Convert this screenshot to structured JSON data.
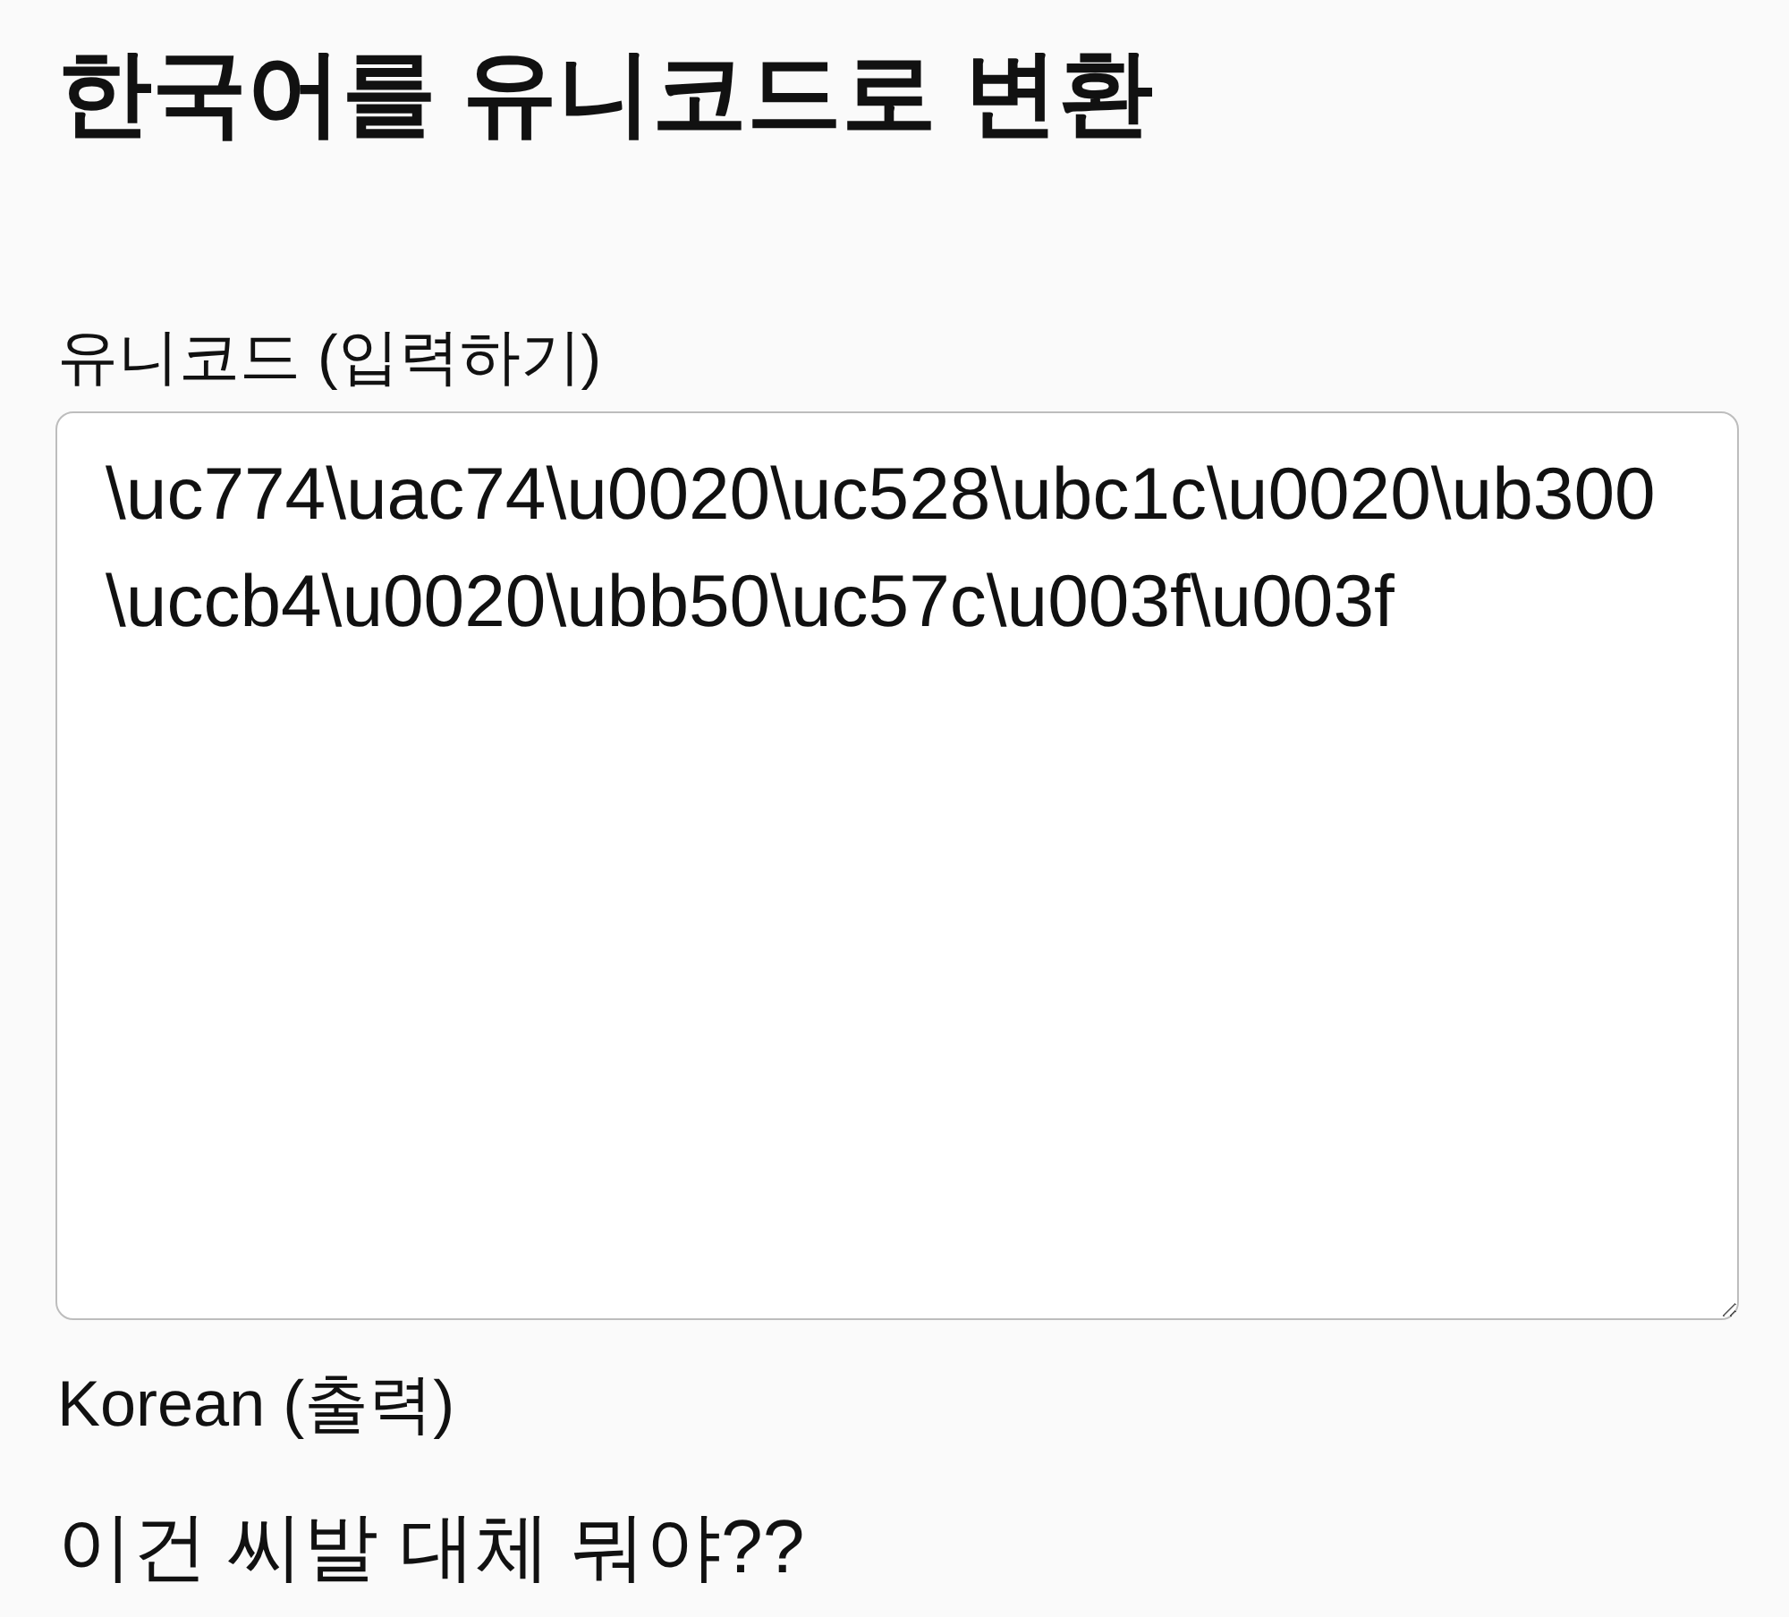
{
  "title": "한국어를 유니코드로 변환",
  "input": {
    "label": "유니코드 (입력하기)",
    "value": "\\uc774\\uac74\\u0020\\uc528\\ubc1c\\u0020\\ub300\\uccb4\\u0020\\ubb50\\uc57c\\u003f\\u003f"
  },
  "output": {
    "label": "Korean (출력)",
    "value": "이건 씨발 대체 뭐야??"
  }
}
